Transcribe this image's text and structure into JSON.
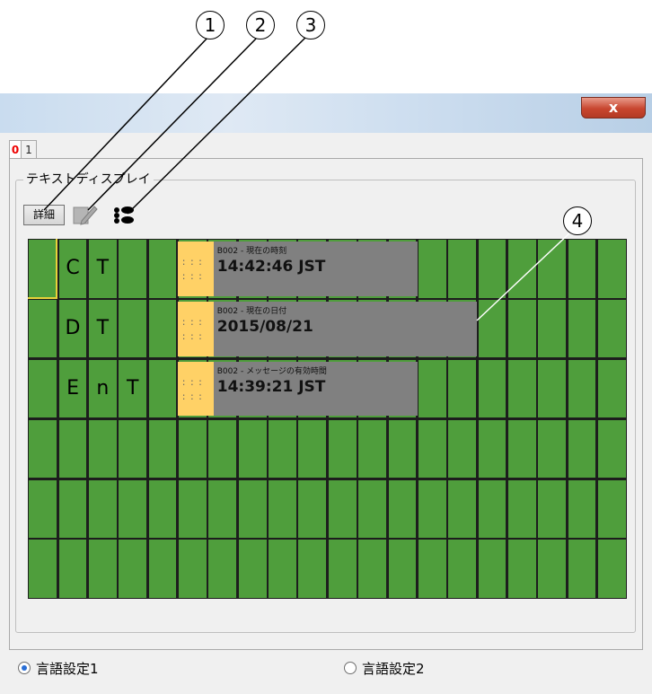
{
  "callouts": [
    "1",
    "2",
    "3",
    "4"
  ],
  "window": {
    "close_label": "x"
  },
  "tabs": [
    "0",
    "1"
  ],
  "group_label": "テキストディスプレイ",
  "toolbar": {
    "detail_label": "詳細",
    "pencil_icon": "pencil-icon",
    "dots_icon": "dots-icon"
  },
  "colors": {
    "grid_cell": "#4f9e3c",
    "grid_line": "#1d1d1d",
    "message_bg": "#808080",
    "message_marker": "#ffd166"
  },
  "display": {
    "rows": [
      {
        "chars": [
          "C",
          "T"
        ]
      },
      {
        "chars": [
          "D",
          "T"
        ]
      },
      {
        "chars": [
          "E",
          "n",
          "T"
        ]
      }
    ],
    "messages": [
      {
        "title": "B002 - 現在の時刻",
        "value": "14:42:46 JST",
        "marker": ": : :"
      },
      {
        "title": "B002 - 現在の日付",
        "value": "2015/08/21",
        "marker": ": : :"
      },
      {
        "title": "B002 - メッセージの有効時間",
        "value": "14:39:21 JST",
        "marker": ": : :"
      }
    ]
  },
  "language": {
    "option1": "言語設定1",
    "option2": "言語設定2",
    "selected": "言語設定1"
  }
}
